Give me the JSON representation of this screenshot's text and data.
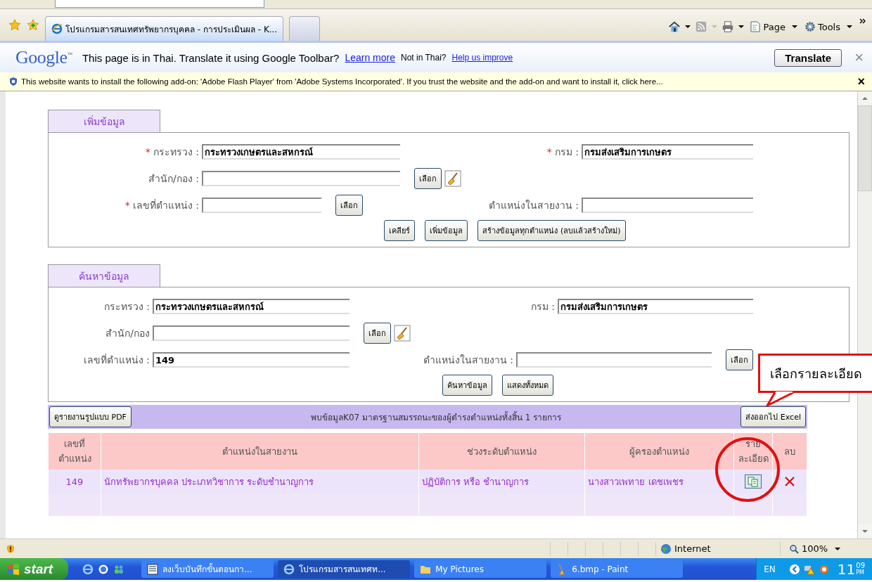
{
  "browser": {
    "tabs": [
      {
        "title": "โปรแกรมสารสนเทศทรัพยากรบุคคล - การประเมินผล - K...",
        "selected": true
      },
      {
        "selected": false
      }
    ],
    "command_bar": [
      "Page",
      "Tools"
    ],
    "google_bar": {
      "logo": "Google",
      "tm": "™",
      "message": "This page is in Thai.  Translate it using Google Toolbar?",
      "learn_more": "Learn more",
      "not_in_thai": "Not in Thai?",
      "help": "Help us improve",
      "translate": "Translate",
      "close": "×"
    },
    "info_bar": {
      "text": "This website wants to install the following add-on: 'Adobe Flash Player' from 'Adobe Systems Incorporated'. If you trust the website and the add-on and want to install it, click here...",
      "close": "×"
    }
  },
  "add_form": {
    "title": "เพิ่มข้อมูล",
    "rows": [
      {
        "left": {
          "marker": "*",
          "label": "กระทรวง :",
          "value": "กระทรวงเกษตรและสหกรณ์"
        },
        "right": {
          "marker": "*",
          "label": "กรม :",
          "value": "กรมส่งเสริมการเกษตร"
        }
      },
      {
        "left": {
          "label": "สำนัก/กอง :",
          "button": "เลือก",
          "clear": true
        }
      },
      {
        "left": {
          "marker": "*",
          "label": "เลขที่ตำแหน่ง :",
          "button": "เลือก"
        },
        "right": {
          "label": "ตำแหน่งในสายงาน :"
        }
      }
    ],
    "buttons": [
      "เคลียร์",
      "เพิ่มข้อมูล",
      "สร้างข้อมูลทุกตำแหน่ง (ลบแล้วสร้างใหม่)"
    ]
  },
  "search_form": {
    "title": "ค้นหาข้อมูล",
    "rows": [
      {
        "left": {
          "label": "กระทรวง :",
          "value": "กระทรวงเกษตรและสหกรณ์"
        },
        "right": {
          "label": "กรม :",
          "value": "กรมส่งเสริมการเกษตร"
        }
      },
      {
        "left": {
          "label": "สำนัก/กอง",
          "button": "เลือก",
          "clear": true
        }
      },
      {
        "left": {
          "label": "เลขที่ตำแหน่ง :",
          "value": "149"
        },
        "right": {
          "label": "ตำแหน่งในสายงาน :",
          "button": "เลือก"
        }
      }
    ],
    "buttons": [
      "ค้นหาข้อมูล",
      "แสดงทั้งหมด"
    ]
  },
  "results": {
    "pdf_button": "ดูรายงานรูปแบบ PDF",
    "summary": "พบข้อมูลK07 มาตรฐานสมรรถนะของผู้ดำรงตำแหน่งทั้งสิ้น 1 รายการ",
    "excel_button": "ส่งออกไป Excel",
    "columns": [
      "เลขที่ตำแหน่ง",
      "ตำแหน่งในสายงาน",
      "ช่วงระดับตำแหน่ง",
      "ผู้ครองตำแหน่ง",
      "ราย ละเอียด",
      "ลบ"
    ],
    "rows": [
      {
        "number": "149",
        "position": "นักทรัพยากรบุคคล ประเภทวิชาการ ระดับชำนาญการ",
        "level_range": "ปฏิบัติการ หรือ ชำนาญการ",
        "holder": "นางสาวเพทาย เดชเพชร"
      }
    ]
  },
  "callout": {
    "text": "เลือกรายละเอียด"
  },
  "status_bar": {
    "zone": "Internet",
    "zoom": "100%"
  },
  "taskbar": {
    "start": "start",
    "items": [
      {
        "label": "ลงเว็บบันทึกขั้นตอนกา...",
        "kind": "word",
        "selected": false
      },
      {
        "label": "โปรแกรมสารสนเทศท...",
        "kind": "ie",
        "selected": true
      },
      {
        "label": "My Pictures",
        "kind": "folder",
        "selected": false
      },
      {
        "label": "6.bmp - Paint",
        "kind": "paint",
        "selected": false
      }
    ],
    "language": "EN",
    "hour": "11",
    "minute": "09",
    "ampm": "PM"
  }
}
